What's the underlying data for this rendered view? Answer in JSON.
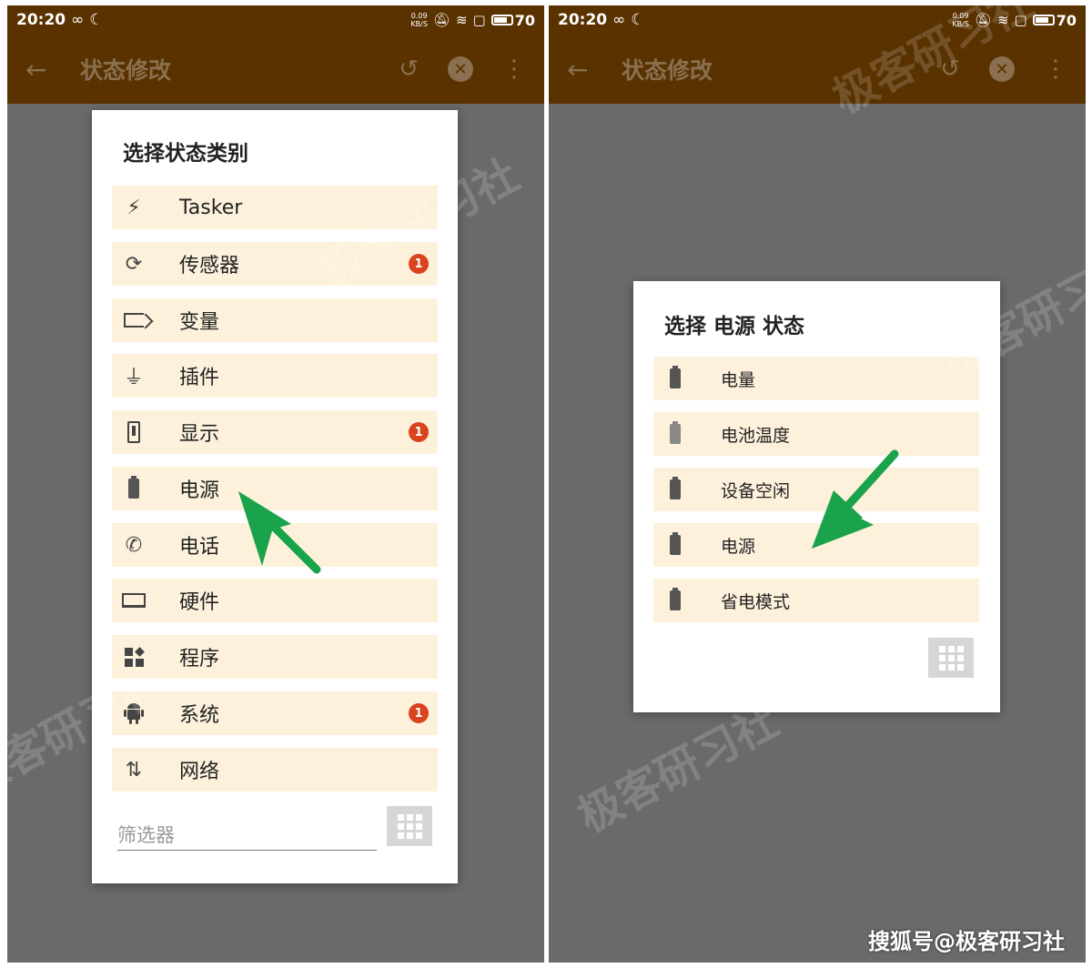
{
  "status": {
    "time": "20:20",
    "net_speed": "0.09",
    "net_unit": "KB/S",
    "battery": "70"
  },
  "appbar": {
    "title": "状态修改"
  },
  "left_dialog": {
    "title": "选择状态类别",
    "items": [
      {
        "label": "Tasker",
        "icon": "lightning-icon"
      },
      {
        "label": "传感器",
        "icon": "screen-rotation-icon",
        "badge": "1"
      },
      {
        "label": "变量",
        "icon": "label-tag-icon"
      },
      {
        "label": "插件",
        "icon": "plug-icon"
      },
      {
        "label": "显示",
        "icon": "phone-icon",
        "badge": "1"
      },
      {
        "label": "电源",
        "icon": "battery-icon"
      },
      {
        "label": "电话",
        "icon": "call-icon"
      },
      {
        "label": "硬件",
        "icon": "laptop-icon"
      },
      {
        "label": "程序",
        "icon": "apps-icon"
      },
      {
        "label": "系统",
        "icon": "android-icon",
        "badge": "1"
      },
      {
        "label": "网络",
        "icon": "data-transfer-icon"
      }
    ],
    "filter_placeholder": "筛选器"
  },
  "right_dialog": {
    "title": "选择 电源 状态",
    "items": [
      {
        "label": "电量",
        "icon": "battery-icon"
      },
      {
        "label": "电池温度",
        "icon": "battery-icon"
      },
      {
        "label": "设备空闲",
        "icon": "battery-icon"
      },
      {
        "label": "电源",
        "icon": "battery-icon"
      },
      {
        "label": "省电模式",
        "icon": "battery-icon"
      }
    ]
  },
  "watermark": "极客研习社",
  "credit": "搜狐号@极客研习社",
  "colors": {
    "appbar": "#5a3200",
    "item_bg": "#fdf1dc",
    "badge": "#d9431e",
    "arrow": "#1aa34a",
    "overlay": "#6a6a6a"
  }
}
